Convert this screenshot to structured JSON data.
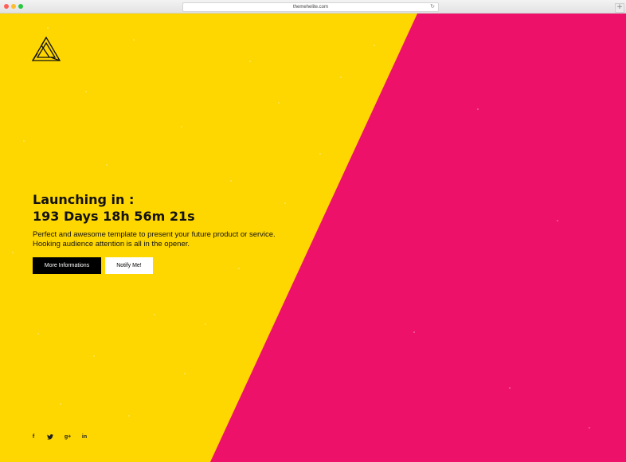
{
  "browser": {
    "url": "themehelite.com"
  },
  "hero": {
    "title_line1": "Launching in :",
    "countdown": "193 Days 18h 56m 21s",
    "description_line1": "Perfect and awesome template to present your future product or service.",
    "description_line2": "Hooking audience attention is all in the opener.",
    "primary_button": "More Informations",
    "secondary_button": "Notify Me!"
  },
  "social": {
    "facebook": "f",
    "twitter": "🐦",
    "googleplus": "g+",
    "linkedin": "in"
  },
  "colors": {
    "yellow": "#ffd700",
    "pink": "#ee1169",
    "black": "#000000",
    "white": "#ffffff"
  },
  "icons": [
    "penrose-triangle-logo-icon",
    "facebook-icon",
    "twitter-icon",
    "google-plus-icon",
    "linkedin-icon",
    "reload-icon"
  ]
}
